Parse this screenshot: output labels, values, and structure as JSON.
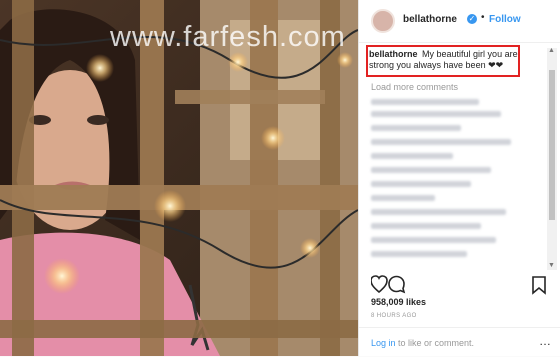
{
  "post": {
    "username": "bellathorne",
    "verified_symbol": "✓",
    "separator": "•",
    "follow_label": "Follow",
    "caption_username": "bellathorne",
    "caption_text": "My beautiful girl you are strong you always have been ❤❤",
    "load_more": "Load more comments",
    "likes": "958,009 likes",
    "timestamp": "8 HOURS AGO",
    "login_link": "Log in",
    "login_rest": " to like or comment.",
    "more_symbol": "…"
  },
  "watermark": "www.farfesh.com",
  "colors": {
    "accent": "#3897f0",
    "highlight_box": "#e22222"
  },
  "icons": [
    "heart-icon",
    "comment-icon",
    "bookmark-icon",
    "verified-icon"
  ]
}
